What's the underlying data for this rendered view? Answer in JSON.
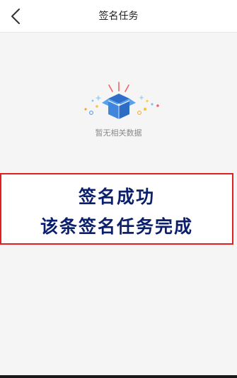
{
  "nav": {
    "title": "签名任务",
    "back_icon": "chevron-left-icon"
  },
  "empty_state": {
    "icon": "empty-box-icon",
    "text": "暂无相关数据"
  },
  "banner": {
    "line1": "签名成功",
    "line2": "该条签名任务完成",
    "border_color": "#e02020",
    "text_color": "#0b1f6b"
  },
  "colors": {
    "accent": "#4a90e2",
    "background": "#f5f5f5"
  }
}
